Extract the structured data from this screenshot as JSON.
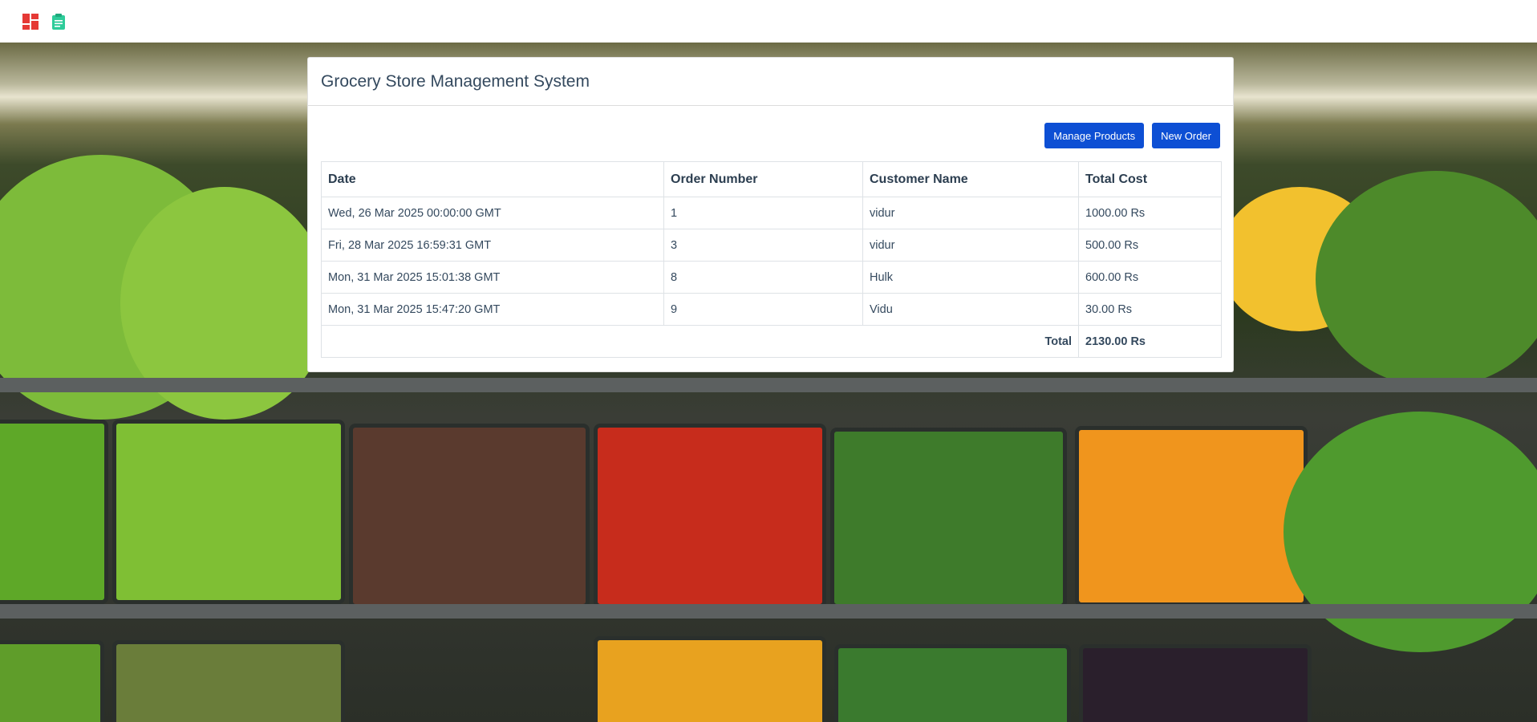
{
  "nav": {
    "dashboard_icon": "dashboard-grid-icon",
    "clipboard_icon": "clipboard-icon",
    "dashboard_color": "#e53935",
    "clipboard_color": "#2ecc9a"
  },
  "card": {
    "title": "Grocery Store Management System",
    "manage_products_label": "Manage Products",
    "new_order_label": "New Order",
    "button_color": "#0d4fd4"
  },
  "table": {
    "headers": [
      "Date",
      "Order Number",
      "Customer Name",
      "Total Cost"
    ],
    "rows": [
      [
        "Wed, 26 Mar 2025 00:00:00 GMT",
        "1",
        "vidur",
        "1000.00 Rs"
      ],
      [
        "Fri, 28 Mar 2025 16:59:31 GMT",
        "3",
        "vidur",
        "500.00 Rs"
      ],
      [
        "Mon, 31 Mar 2025 15:01:38 GMT",
        "8",
        "Hulk",
        "600.00 Rs"
      ],
      [
        "Mon, 31 Mar 2025 15:47:20 GMT",
        "9",
        "Vidu",
        "30.00 Rs"
      ]
    ],
    "total_label": "Total",
    "total_value": "2130.00 Rs"
  }
}
